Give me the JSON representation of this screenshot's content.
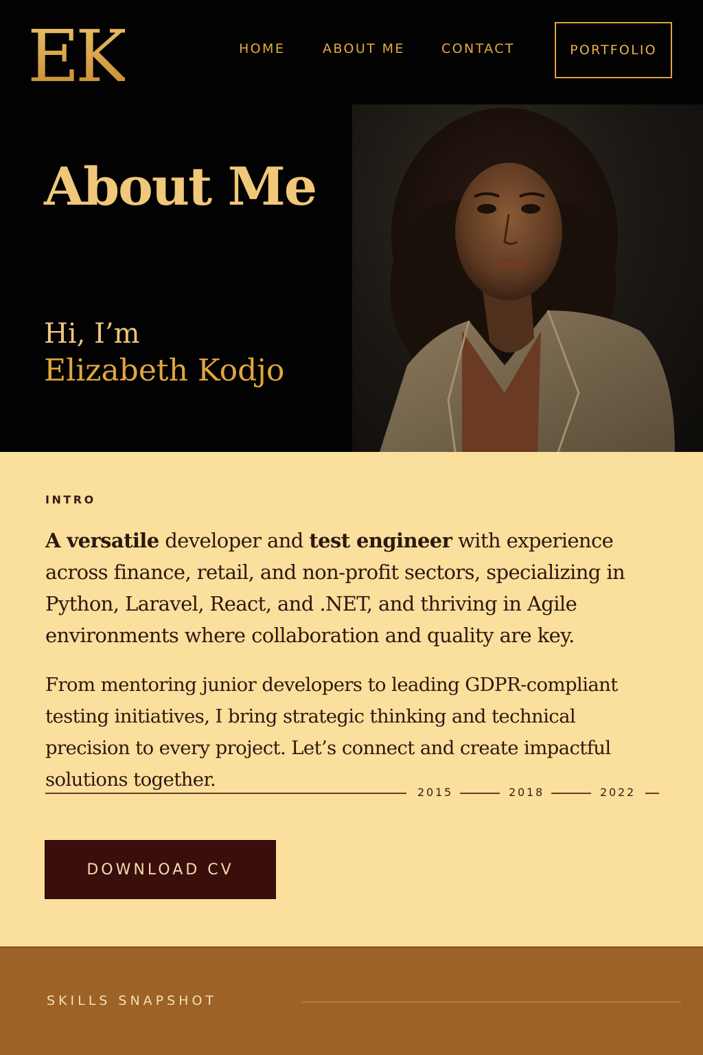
{
  "logo": {
    "text": "EK"
  },
  "nav": {
    "items": [
      "HOME",
      "ABOUT ME",
      "CONTACT"
    ],
    "cta_label": "PORTFOLIO"
  },
  "hero": {
    "title": "About Me",
    "greeting": "Hi, I’m",
    "name": "Elizabeth Kodjo",
    "photo": "portrait of Elizabeth Kodjo"
  },
  "intro": {
    "label": "INTRO",
    "p1_bold_a": "A versatile",
    "p1_text_a": " developer and ",
    "p1_bold_b": "test engineer",
    "p1_text_b": " with experience across finance, retail, and non-profit sectors, specializing in Python, Laravel, React, and .NET, and thriving in Agile environments where collaboration and quality are key.",
    "p2": "From mentoring junior developers to leading GDPR-compliant testing initiatives, I bring strategic thinking and technical precision to every project. Let’s connect and create impactful solutions together.",
    "timeline_years": [
      "2015",
      "2018",
      "2022"
    ],
    "download_label": "DOWNLOAD CV"
  },
  "skills": {
    "label": "SKILLS SNAPSHOT"
  },
  "colors": {
    "hero_bg": "#020202",
    "gold": "#e0a63c",
    "cream": "#fbdf9c",
    "button_bg": "#3a0e0a",
    "skills_bg": "#9d6226"
  }
}
